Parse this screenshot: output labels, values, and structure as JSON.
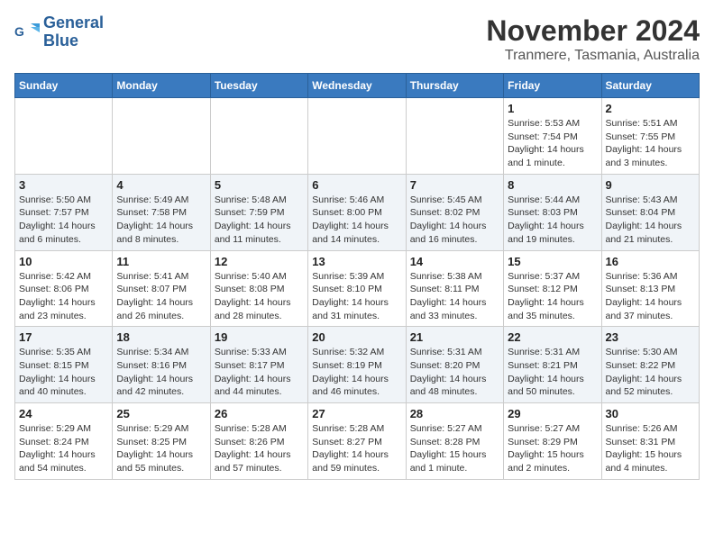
{
  "header": {
    "logo_line1": "General",
    "logo_line2": "Blue",
    "month": "November 2024",
    "location": "Tranmere, Tasmania, Australia"
  },
  "days_of_week": [
    "Sunday",
    "Monday",
    "Tuesday",
    "Wednesday",
    "Thursday",
    "Friday",
    "Saturday"
  ],
  "weeks": [
    [
      {
        "day": "",
        "info": ""
      },
      {
        "day": "",
        "info": ""
      },
      {
        "day": "",
        "info": ""
      },
      {
        "day": "",
        "info": ""
      },
      {
        "day": "",
        "info": ""
      },
      {
        "day": "1",
        "info": "Sunrise: 5:53 AM\nSunset: 7:54 PM\nDaylight: 14 hours and 1 minute."
      },
      {
        "day": "2",
        "info": "Sunrise: 5:51 AM\nSunset: 7:55 PM\nDaylight: 14 hours and 3 minutes."
      }
    ],
    [
      {
        "day": "3",
        "info": "Sunrise: 5:50 AM\nSunset: 7:57 PM\nDaylight: 14 hours and 6 minutes."
      },
      {
        "day": "4",
        "info": "Sunrise: 5:49 AM\nSunset: 7:58 PM\nDaylight: 14 hours and 8 minutes."
      },
      {
        "day": "5",
        "info": "Sunrise: 5:48 AM\nSunset: 7:59 PM\nDaylight: 14 hours and 11 minutes."
      },
      {
        "day": "6",
        "info": "Sunrise: 5:46 AM\nSunset: 8:00 PM\nDaylight: 14 hours and 14 minutes."
      },
      {
        "day": "7",
        "info": "Sunrise: 5:45 AM\nSunset: 8:02 PM\nDaylight: 14 hours and 16 minutes."
      },
      {
        "day": "8",
        "info": "Sunrise: 5:44 AM\nSunset: 8:03 PM\nDaylight: 14 hours and 19 minutes."
      },
      {
        "day": "9",
        "info": "Sunrise: 5:43 AM\nSunset: 8:04 PM\nDaylight: 14 hours and 21 minutes."
      }
    ],
    [
      {
        "day": "10",
        "info": "Sunrise: 5:42 AM\nSunset: 8:06 PM\nDaylight: 14 hours and 23 minutes."
      },
      {
        "day": "11",
        "info": "Sunrise: 5:41 AM\nSunset: 8:07 PM\nDaylight: 14 hours and 26 minutes."
      },
      {
        "day": "12",
        "info": "Sunrise: 5:40 AM\nSunset: 8:08 PM\nDaylight: 14 hours and 28 minutes."
      },
      {
        "day": "13",
        "info": "Sunrise: 5:39 AM\nSunset: 8:10 PM\nDaylight: 14 hours and 31 minutes."
      },
      {
        "day": "14",
        "info": "Sunrise: 5:38 AM\nSunset: 8:11 PM\nDaylight: 14 hours and 33 minutes."
      },
      {
        "day": "15",
        "info": "Sunrise: 5:37 AM\nSunset: 8:12 PM\nDaylight: 14 hours and 35 minutes."
      },
      {
        "day": "16",
        "info": "Sunrise: 5:36 AM\nSunset: 8:13 PM\nDaylight: 14 hours and 37 minutes."
      }
    ],
    [
      {
        "day": "17",
        "info": "Sunrise: 5:35 AM\nSunset: 8:15 PM\nDaylight: 14 hours and 40 minutes."
      },
      {
        "day": "18",
        "info": "Sunrise: 5:34 AM\nSunset: 8:16 PM\nDaylight: 14 hours and 42 minutes."
      },
      {
        "day": "19",
        "info": "Sunrise: 5:33 AM\nSunset: 8:17 PM\nDaylight: 14 hours and 44 minutes."
      },
      {
        "day": "20",
        "info": "Sunrise: 5:32 AM\nSunset: 8:19 PM\nDaylight: 14 hours and 46 minutes."
      },
      {
        "day": "21",
        "info": "Sunrise: 5:31 AM\nSunset: 8:20 PM\nDaylight: 14 hours and 48 minutes."
      },
      {
        "day": "22",
        "info": "Sunrise: 5:31 AM\nSunset: 8:21 PM\nDaylight: 14 hours and 50 minutes."
      },
      {
        "day": "23",
        "info": "Sunrise: 5:30 AM\nSunset: 8:22 PM\nDaylight: 14 hours and 52 minutes."
      }
    ],
    [
      {
        "day": "24",
        "info": "Sunrise: 5:29 AM\nSunset: 8:24 PM\nDaylight: 14 hours and 54 minutes."
      },
      {
        "day": "25",
        "info": "Sunrise: 5:29 AM\nSunset: 8:25 PM\nDaylight: 14 hours and 55 minutes."
      },
      {
        "day": "26",
        "info": "Sunrise: 5:28 AM\nSunset: 8:26 PM\nDaylight: 14 hours and 57 minutes."
      },
      {
        "day": "27",
        "info": "Sunrise: 5:28 AM\nSunset: 8:27 PM\nDaylight: 14 hours and 59 minutes."
      },
      {
        "day": "28",
        "info": "Sunrise: 5:27 AM\nSunset: 8:28 PM\nDaylight: 15 hours and 1 minute."
      },
      {
        "day": "29",
        "info": "Sunrise: 5:27 AM\nSunset: 8:29 PM\nDaylight: 15 hours and 2 minutes."
      },
      {
        "day": "30",
        "info": "Sunrise: 5:26 AM\nSunset: 8:31 PM\nDaylight: 15 hours and 4 minutes."
      }
    ]
  ]
}
